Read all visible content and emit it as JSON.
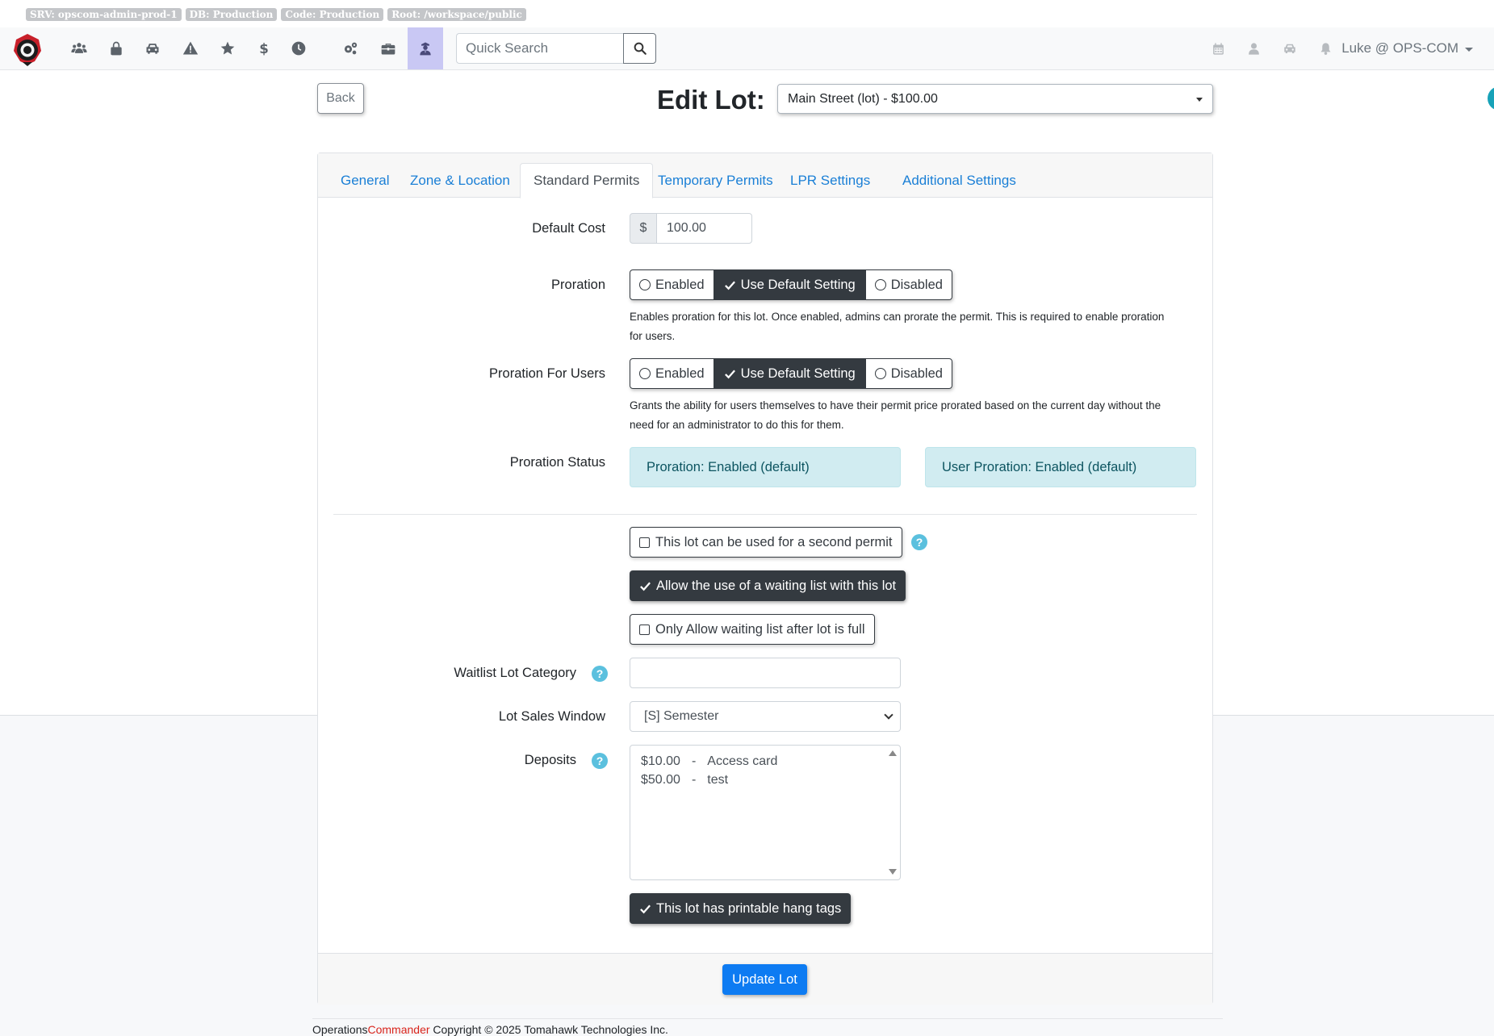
{
  "env_badges": [
    "SRV: opscom-admin-prod-1",
    "DB: Production",
    "Code: Production",
    "Root: /workspace/public"
  ],
  "nav": {
    "left_icons": [
      "users-icon",
      "lock-icon",
      "car-icon",
      "warning-icon",
      "star-icon",
      "dollar-icon",
      "clock-icon",
      "cogs-icon",
      "toolbox-icon",
      "officer-icon"
    ],
    "active_icon": "officer-icon",
    "search_placeholder": "Quick Search",
    "right_icons": [
      "calendar-icon",
      "user-icon",
      "car-icon",
      "bell-icon"
    ],
    "user_label": "Luke @ OPS-COM"
  },
  "header": {
    "back_label": "Back",
    "title": "Edit Lot:",
    "lot_selected": "Main Street (lot) - $100.00"
  },
  "tabs": [
    {
      "label": "General",
      "active": false
    },
    {
      "label": "Zone & Location",
      "active": false
    },
    {
      "label": "Standard Permits",
      "active": true
    },
    {
      "label": "Temporary Permits",
      "active": false
    },
    {
      "label": "LPR Settings",
      "active": false
    },
    {
      "label": "Additional Settings",
      "active": false
    }
  ],
  "form": {
    "default_cost_label": "Default Cost",
    "currency_symbol": "$",
    "default_cost_value": "100.00",
    "proration_label": "Proration",
    "proration_options": [
      "Enabled",
      "Use Default Setting",
      "Disabled"
    ],
    "proration_selected": "Use Default Setting",
    "proration_help": "Enables proration for this lot. Once enabled, admins can prorate the permit. This is required to enable proration",
    "proration_help_2": "for users.",
    "proration_users_label": "Proration For Users",
    "proration_users_options": [
      "Enabled",
      "Use Default Setting",
      "Disabled"
    ],
    "proration_users_selected": "Use Default Setting",
    "proration_users_help": "Grants the ability for users themselves to have their permit price prorated based on the current day without the",
    "proration_users_help_2": "need for an administrator to do this for them.",
    "proration_status_label": "Proration Status",
    "proration_status": "Proration: Enabled (default)",
    "user_proration_status": "User Proration: Enabled (default)",
    "second_permit_label": "This lot can be used for a second permit",
    "second_permit_checked": false,
    "waiting_list_label": "Allow the use of a waiting list with this lot",
    "waiting_list_checked": true,
    "waiting_full_label": "Only Allow waiting list after lot is full",
    "waiting_full_checked": false,
    "waitlist_category_label": "Waitlist Lot Category",
    "waitlist_category_value": "",
    "sales_window_label": "Lot Sales Window",
    "sales_window_value": "[S] Semester",
    "deposits_label": "Deposits",
    "deposits": [
      {
        "amount": "$10.00",
        "sep": "-",
        "name": "Access card"
      },
      {
        "amount": "$50.00",
        "sep": "-",
        "name": "test"
      }
    ],
    "hang_tags_label": "This lot has printable hang tags",
    "hang_tags_checked": true,
    "submit_label": "Update Lot",
    "help_glyph": "?"
  },
  "footer": {
    "brand_1": "Operations",
    "brand_2": "Commander",
    "copyright": " Copyright © 2025 Tomahawk Technologies Inc."
  },
  "colors": {
    "primary": "#0d7bf2",
    "dark": "#343a40",
    "info_bg": "#d1ecf1",
    "help_icon": "#5bc0de",
    "active_nav": "#c9c8f4"
  }
}
